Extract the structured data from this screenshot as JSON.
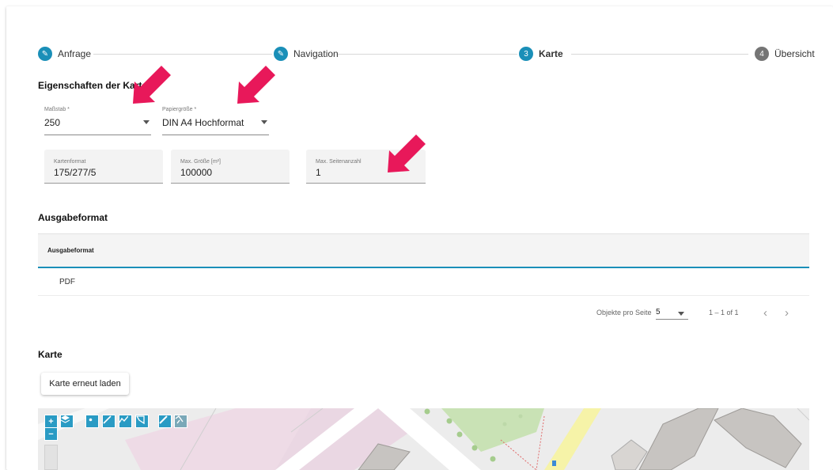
{
  "stepper": {
    "steps": [
      {
        "label": "Anfrage",
        "marker": "✎",
        "state": "done"
      },
      {
        "label": "Navigation",
        "marker": "✎",
        "state": "done"
      },
      {
        "label": "Karte",
        "marker": "3",
        "state": "active"
      },
      {
        "label": "Übersicht",
        "marker": "4",
        "state": "todo"
      }
    ]
  },
  "map_props": {
    "title": "Eigenschaften der Karte",
    "scale": {
      "label": "Maßstab *",
      "value": "250"
    },
    "paper": {
      "label": "Papiergröße *",
      "value": "DIN A4 Hochformat"
    },
    "format": {
      "label": "Kartenformat",
      "value": "175/277/5"
    },
    "max_size": {
      "label": "Max. Größe [m²]",
      "value": "100000"
    },
    "max_pages": {
      "label": "Max. Seitenanzahl",
      "value": "1"
    }
  },
  "output": {
    "title": "Ausgabeformat",
    "column_header": "Ausgabeformat",
    "rows": [
      "PDF"
    ],
    "paginator": {
      "per_page_label": "Objekte pro Seite",
      "per_page_value": "5",
      "range": "1 – 1 of 1"
    }
  },
  "map": {
    "title": "Karte",
    "reload_label": "Karte erneut laden",
    "tools": [
      "zoom-in-icon",
      "zoom-out-icon",
      "layers-icon",
      "point-icon",
      "line-icon",
      "polyline-icon",
      "polygon-icon",
      "edit-icon",
      "measure-icon"
    ]
  },
  "colors": {
    "accent": "#1a8fb8",
    "annotation_arrow": "#e8185a"
  }
}
